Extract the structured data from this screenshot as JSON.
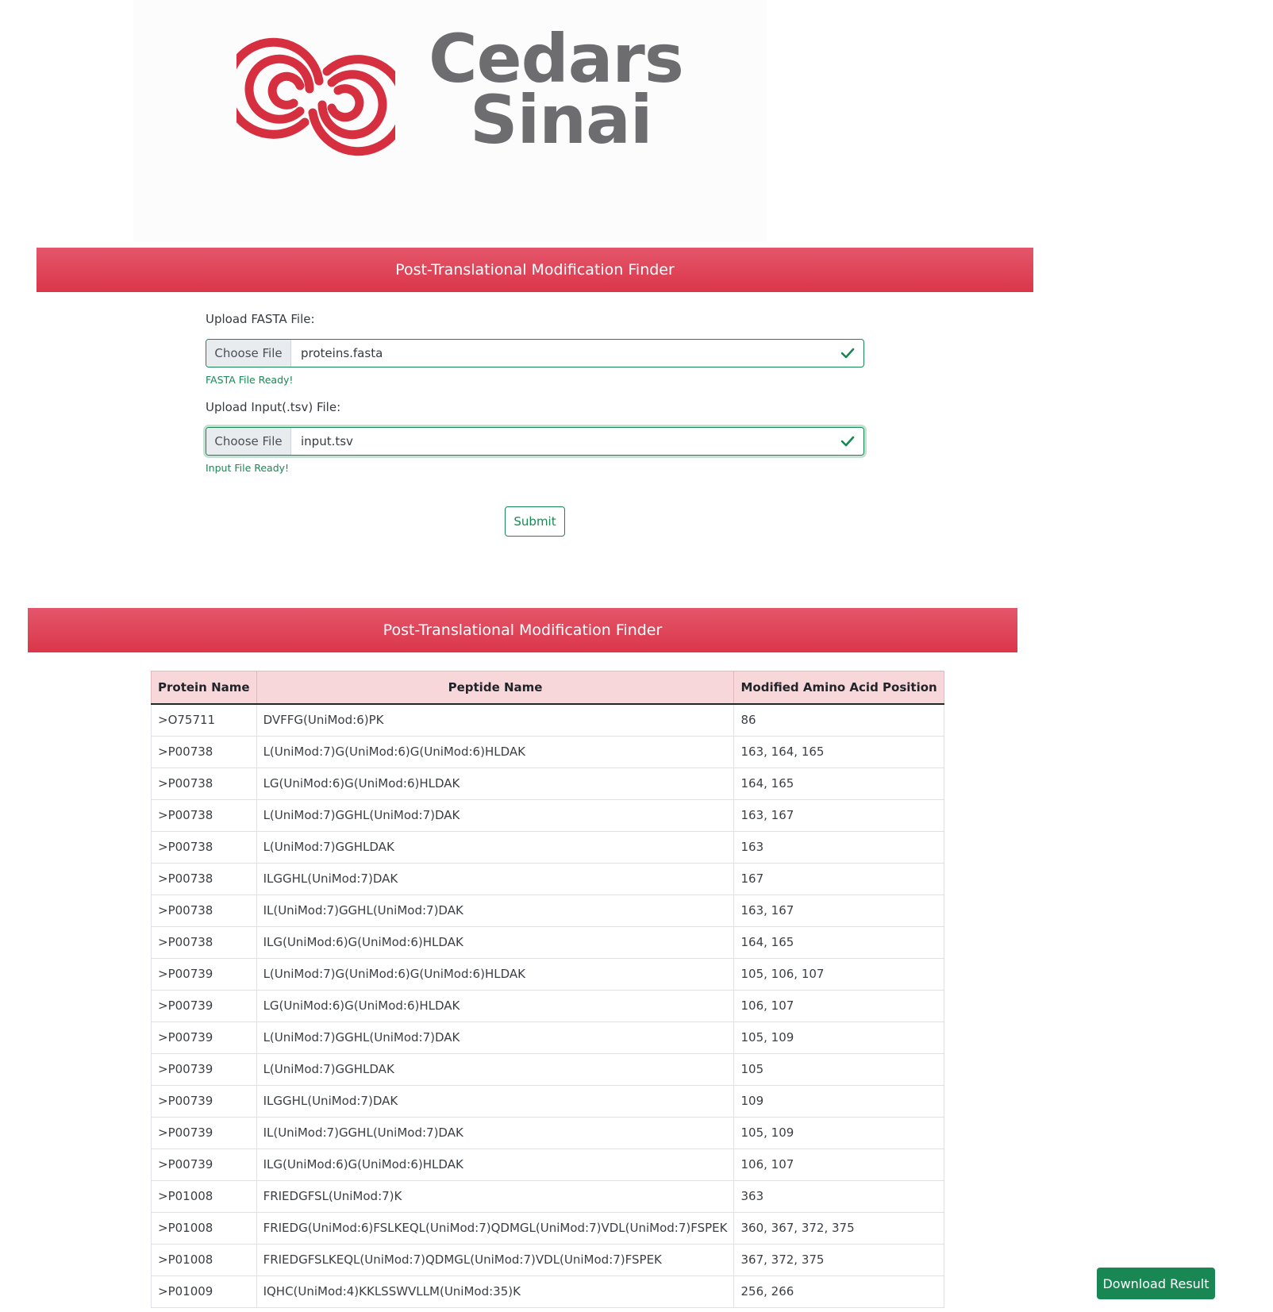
{
  "brand": {
    "logo_line1": "Cedars",
    "logo_line2": "Sinai",
    "mark_color": "#d62f3f",
    "text_color": "#6d6d6f"
  },
  "banner_top": {
    "title": "Post-Translational Modification Finder"
  },
  "banner_bottom": {
    "title": "Post-Translational Modification Finder"
  },
  "form": {
    "fasta": {
      "label": "Upload FASTA File:",
      "button": "Choose File",
      "file_name": "proteins.fasta",
      "status": "FASTA File Ready!"
    },
    "input": {
      "label": "Upload Input(.tsv) File:",
      "button": "Choose File",
      "file_name": "input.tsv",
      "status": "Input File Ready!"
    },
    "submit_label": "Submit"
  },
  "table": {
    "headers": [
      "Protein Name",
      "Peptide Name",
      "Modified Amino Acid Position"
    ],
    "rows": [
      [
        ">O75711",
        "DVFFG(UniMod:6)PK",
        "86"
      ],
      [
        ">P00738",
        "L(UniMod:7)G(UniMod:6)G(UniMod:6)HLDAK",
        "163, 164, 165"
      ],
      [
        ">P00738",
        "LG(UniMod:6)G(UniMod:6)HLDAK",
        "164, 165"
      ],
      [
        ">P00738",
        "L(UniMod:7)GGHL(UniMod:7)DAK",
        "163, 167"
      ],
      [
        ">P00738",
        "L(UniMod:7)GGHLDAK",
        "163"
      ],
      [
        ">P00738",
        "ILGGHL(UniMod:7)DAK",
        "167"
      ],
      [
        ">P00738",
        "IL(UniMod:7)GGHL(UniMod:7)DAK",
        "163, 167"
      ],
      [
        ">P00738",
        "ILG(UniMod:6)G(UniMod:6)HLDAK",
        "164, 165"
      ],
      [
        ">P00739",
        "L(UniMod:7)G(UniMod:6)G(UniMod:6)HLDAK",
        "105, 106, 107"
      ],
      [
        ">P00739",
        "LG(UniMod:6)G(UniMod:6)HLDAK",
        "106, 107"
      ],
      [
        ">P00739",
        "L(UniMod:7)GGHL(UniMod:7)DAK",
        "105, 109"
      ],
      [
        ">P00739",
        "L(UniMod:7)GGHLDAK",
        "105"
      ],
      [
        ">P00739",
        "ILGGHL(UniMod:7)DAK",
        "109"
      ],
      [
        ">P00739",
        "IL(UniMod:7)GGHL(UniMod:7)DAK",
        "105, 109"
      ],
      [
        ">P00739",
        "ILG(UniMod:6)G(UniMod:6)HLDAK",
        "106, 107"
      ],
      [
        ">P01008",
        "FRIEDGFSL(UniMod:7)K",
        "363"
      ],
      [
        ">P01008",
        "FRIEDG(UniMod:6)FSLKEQL(UniMod:7)QDMGL(UniMod:7)VDL(UniMod:7)FSPEK",
        "360, 367, 372, 375"
      ],
      [
        ">P01008",
        "FRIEDGFSLKEQL(UniMod:7)QDMGL(UniMod:7)VDL(UniMod:7)FSPEK",
        "367, 372, 375"
      ],
      [
        ">P01009",
        "IQHC(UniMod:4)KKLSSWVLLM(UniMod:35)K",
        "256, 266"
      ]
    ]
  },
  "download_label": "Download Result",
  "colors": {
    "banner": "#db3649",
    "success": "#198754",
    "header_bg": "#f8d7da"
  }
}
